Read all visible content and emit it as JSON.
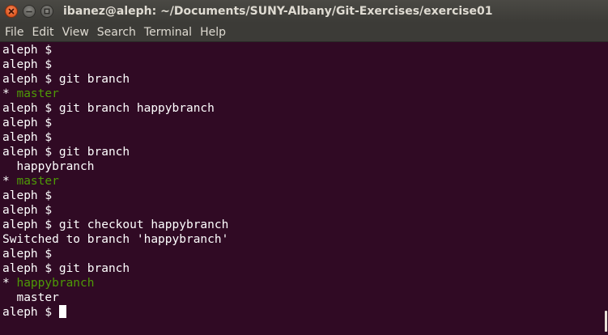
{
  "window": {
    "title": "ibanez@aleph: ~/Documents/SUNY-Albany/Git-Exercises/exercise01"
  },
  "menu": {
    "items": [
      "File",
      "Edit",
      "View",
      "Search",
      "Terminal",
      "Help"
    ]
  },
  "terminal": {
    "lines": [
      {
        "text": "aleph $ "
      },
      {
        "text": "aleph $ "
      },
      {
        "text": "aleph $ git branch"
      },
      {
        "prefix": "* ",
        "text": "master",
        "highlight": true
      },
      {
        "text": "aleph $ git branch happybranch"
      },
      {
        "text": "aleph $ "
      },
      {
        "text": "aleph $ "
      },
      {
        "text": "aleph $ git branch"
      },
      {
        "text": "  happybranch"
      },
      {
        "prefix": "* ",
        "text": "master",
        "highlight": true
      },
      {
        "text": "aleph $ "
      },
      {
        "text": "aleph $ "
      },
      {
        "text": "aleph $ git checkout happybranch"
      },
      {
        "text": "Switched to branch 'happybranch'"
      },
      {
        "text": "aleph $ "
      },
      {
        "text": "aleph $ git branch"
      },
      {
        "prefix": "* ",
        "text": "happybranch",
        "highlight": true
      },
      {
        "text": "  master"
      },
      {
        "text": "aleph $ ",
        "cursor": true
      }
    ]
  },
  "colors": {
    "background": "#300a24",
    "text": "#ffffff",
    "current_branch": "#4e9a06"
  },
  "icons": {
    "close": "close-icon",
    "minimize": "minimize-icon",
    "maximize": "maximize-icon"
  }
}
